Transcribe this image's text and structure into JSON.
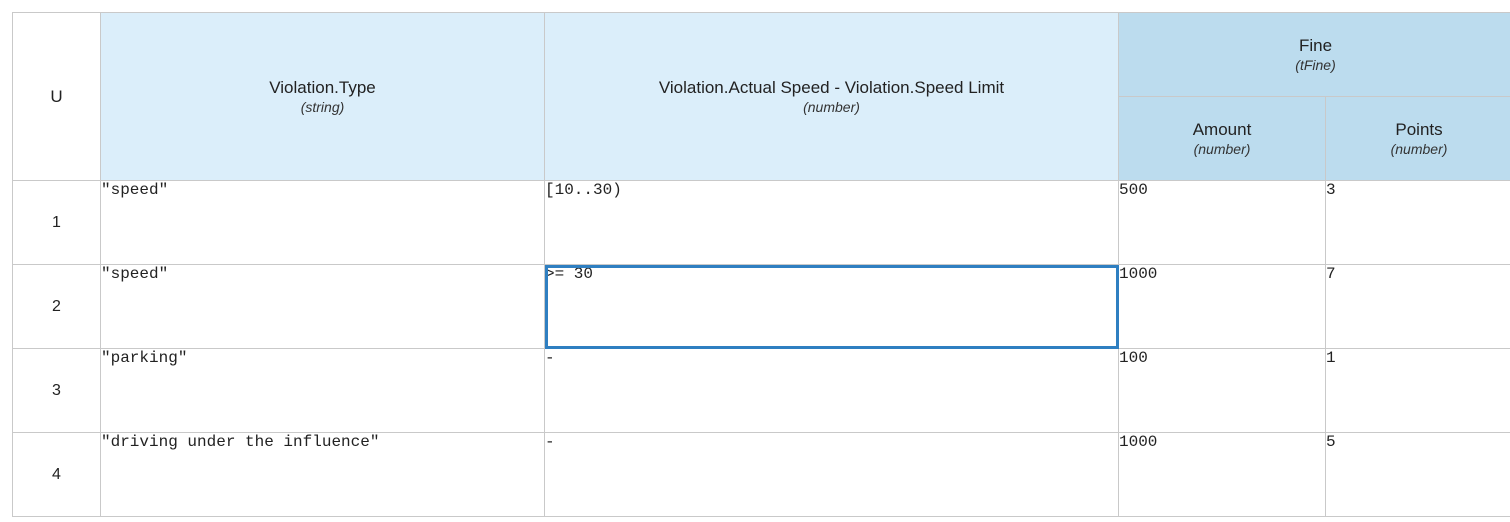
{
  "table": {
    "hit_policy": "U",
    "inputs": [
      {
        "name": "Violation.Type",
        "type": "(string)"
      },
      {
        "name": "Violation.Actual Speed - Violation.Speed Limit",
        "type": "(number)"
      }
    ],
    "output": {
      "name": "Fine",
      "type": "(tFine)",
      "components": [
        {
          "name": "Amount",
          "type": "(number)"
        },
        {
          "name": "Points",
          "type": "(number)"
        }
      ]
    },
    "rules": [
      {
        "num": "1",
        "type": "\"speed\"",
        "speed": "[10..30)",
        "amount": "500",
        "points": "3"
      },
      {
        "num": "2",
        "type": "\"speed\"",
        "speed": ">= 30",
        "amount": "1000",
        "points": "7"
      },
      {
        "num": "3",
        "type": "\"parking\"",
        "speed": "-",
        "amount": "100",
        "points": "1"
      },
      {
        "num": "4",
        "type": "\"driving under the influence\"",
        "speed": "-",
        "amount": "1000",
        "points": "5"
      }
    ],
    "selected_cell": {
      "row": 2,
      "column": "Violation.Actual Speed - Violation.Speed Limit"
    }
  },
  "colors": {
    "input_header_bg": "#dbeefa",
    "output_header_bg": "#bcdcee",
    "grid_line": "#c9c9c9",
    "selection_border": "#2f7fc1"
  }
}
